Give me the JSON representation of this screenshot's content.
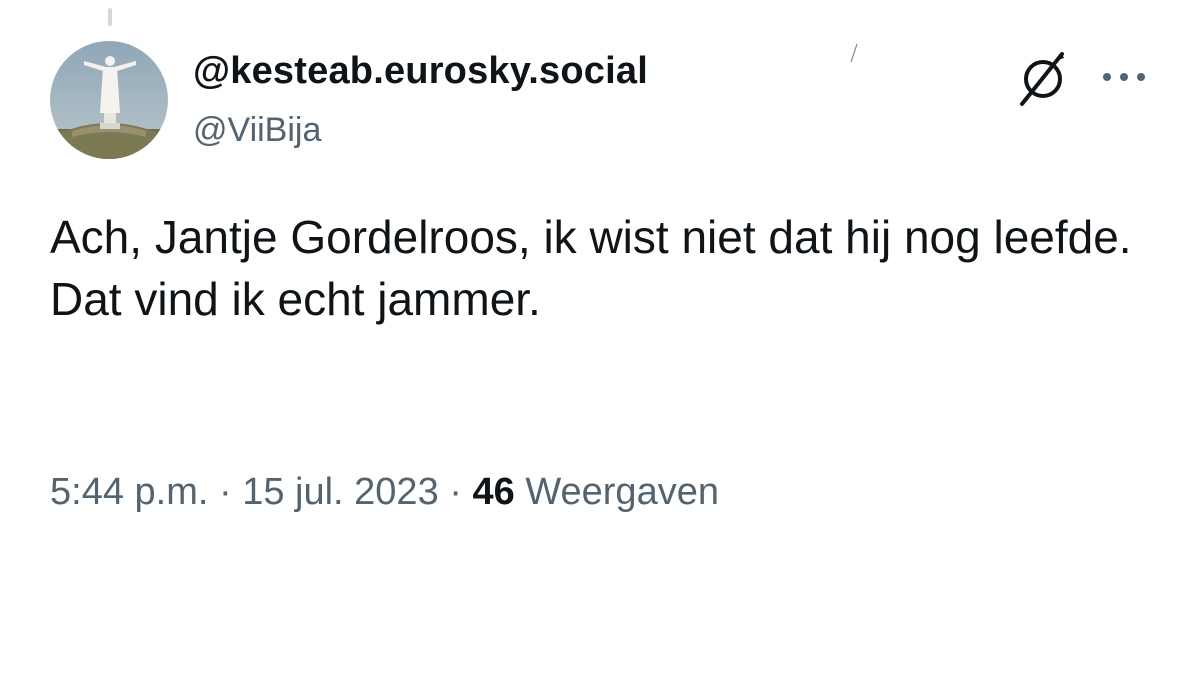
{
  "author": {
    "display_name": "@kesteab.eurosky.social",
    "handle": "@ViiBija",
    "avatar_icon": "statue-avatar"
  },
  "icons": {
    "badge": "slashed-circle-icon",
    "more": "more-dots-icon"
  },
  "tweet": {
    "lines": [
      "Ach,  Jantje Gordelroos, ik wist niet dat hij nog leefde.",
      "Dat vind ik echt jammer."
    ]
  },
  "meta": {
    "time": "5:44 p.m.",
    "separator": "·",
    "date": "15 jul. 2023",
    "views_count": "46",
    "views_label": "Weergaven"
  },
  "colors": {
    "text": "#0f1419",
    "secondary": "#536471",
    "background": "#ffffff"
  }
}
